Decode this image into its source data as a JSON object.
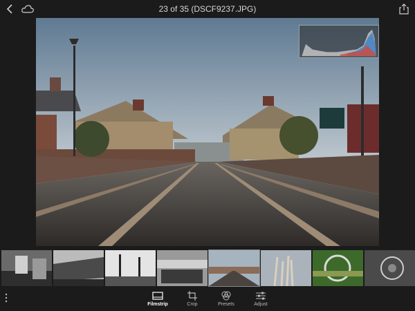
{
  "header": {
    "title": "23 of 35 (DSCF9237.JPG)"
  },
  "toolbar": {
    "tools": [
      {
        "label": "Filmstrip",
        "icon": "filmstrip-icon",
        "active": true
      },
      {
        "label": "Crop",
        "icon": "crop-icon",
        "active": false
      },
      {
        "label": "Presets",
        "icon": "presets-icon",
        "active": false
      },
      {
        "label": "Adjust",
        "icon": "adjust-icon",
        "active": false
      }
    ]
  },
  "filmstrip": {
    "count": 8,
    "selected_index": 3
  },
  "colors": {
    "background": "#1b1b1b",
    "active_label": "#ffffff",
    "inactive_label": "#bbbbbb"
  }
}
